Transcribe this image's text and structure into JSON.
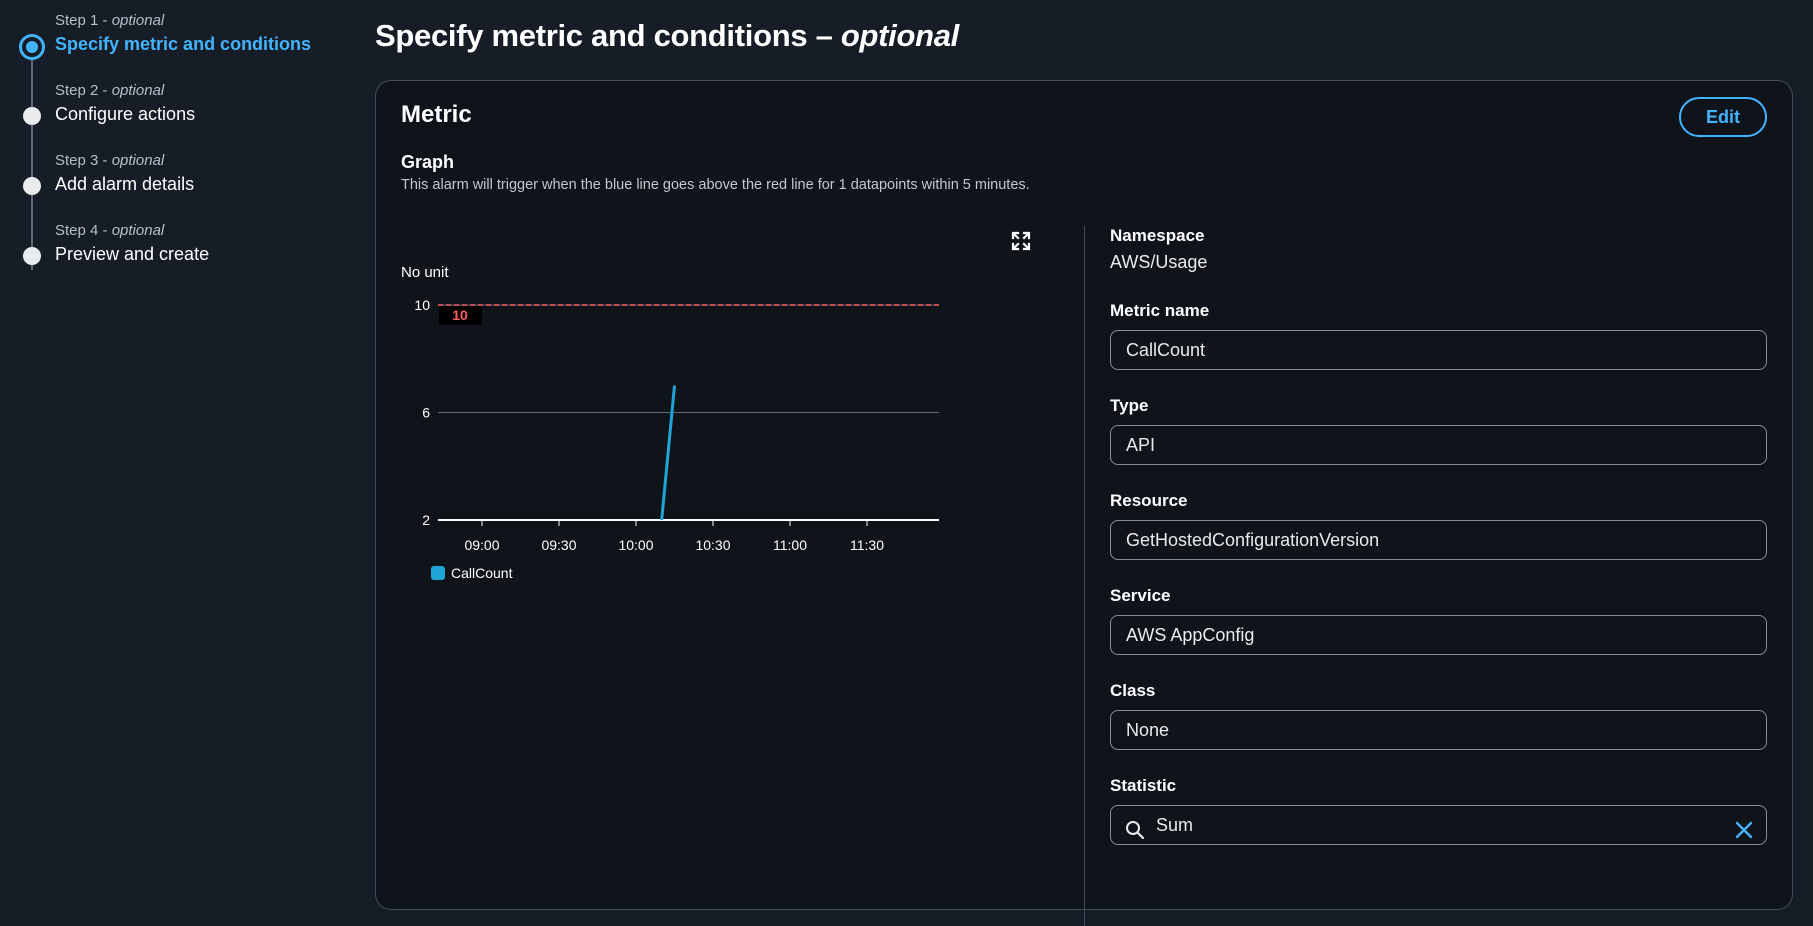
{
  "steps": [
    {
      "sub": "Step 1 - ",
      "opt": "optional",
      "title": "Specify metric and conditions"
    },
    {
      "sub": "Step 2 - ",
      "opt": "optional",
      "title": "Configure actions"
    },
    {
      "sub": "Step 3 - ",
      "opt": "optional",
      "title": "Add alarm details"
    },
    {
      "sub": "Step 4 - ",
      "opt": "optional",
      "title": "Preview and create"
    }
  ],
  "header": {
    "title": "Specify metric and conditions",
    "dash": " – ",
    "optional": "optional"
  },
  "metric": {
    "title": "Metric",
    "edit_label": "Edit",
    "graph_label": "Graph",
    "graph_desc": "This alarm will trigger when the blue line goes above the red line for 1 datapoints within 5 minutes.",
    "unit_label": "No unit"
  },
  "fields": {
    "namespace_label": "Namespace",
    "namespace_value": "AWS/Usage",
    "metric_name_label": "Metric name",
    "metric_name_value": "CallCount",
    "type_label": "Type",
    "type_value": "API",
    "resource_label": "Resource",
    "resource_value": "GetHostedConfigurationVersion",
    "service_label": "Service",
    "service_value": "AWS AppConfig",
    "class_label": "Class",
    "class_value": "None",
    "statistic_label": "Statistic",
    "statistic_value": "Sum"
  },
  "icons": {
    "expand": "expand-icon",
    "search": "search-icon",
    "clear": "close-icon"
  },
  "colors": {
    "accent": "#42b4ff",
    "threshold": "#ff5d64",
    "series": "#1ea5d6",
    "background": "#161d26"
  },
  "chart_data": {
    "type": "line",
    "ylabel": "No unit",
    "yticks": [
      2,
      6,
      10
    ],
    "ylim": [
      2,
      10
    ],
    "xticks": [
      "09:00",
      "09:30",
      "10:00",
      "10:30",
      "11:00",
      "11:30"
    ],
    "threshold": {
      "value": 10,
      "label": "10"
    },
    "series": [
      {
        "name": "CallCount",
        "x": [
          "10:10",
          "10:15"
        ],
        "values": [
          2,
          7
        ]
      }
    ]
  }
}
